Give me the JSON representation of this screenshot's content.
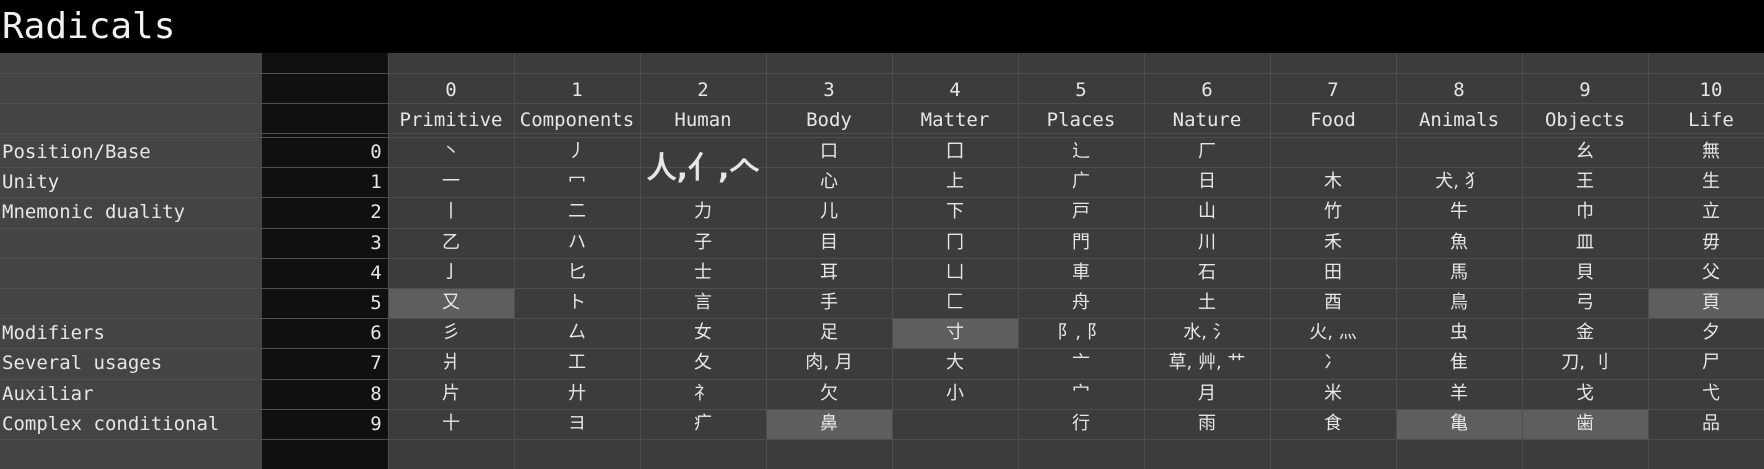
{
  "title": "Radicals",
  "categories": [
    {
      "index": "0",
      "name": "Primitive"
    },
    {
      "index": "1",
      "name": "Components"
    },
    {
      "index": "2",
      "name": "Human"
    },
    {
      "index": "3",
      "name": "Body"
    },
    {
      "index": "4",
      "name": "Matter"
    },
    {
      "index": "5",
      "name": "Places"
    },
    {
      "index": "6",
      "name": "Nature"
    },
    {
      "index": "7",
      "name": "Food"
    },
    {
      "index": "8",
      "name": "Animals"
    },
    {
      "index": "9",
      "name": "Objects"
    },
    {
      "index": "10",
      "name": "Life"
    }
  ],
  "row_labels": [
    "Position/Base",
    "Unity",
    "Mnemonic duality",
    "",
    "",
    "",
    "Modifiers",
    "Several usages",
    "Auxiliar",
    "Complex conditional"
  ],
  "row_numbers": [
    "0",
    "1",
    "2",
    "3",
    "4",
    "5",
    "6",
    "7",
    "8",
    "9"
  ],
  "human_big": "人,亻,𠆢",
  "grid": [
    [
      "丶",
      "丿",
      "",
      "口",
      "囗",
      "辶",
      "厂",
      "",
      "",
      "幺",
      "無"
    ],
    [
      "一",
      "冖",
      "",
      "心",
      "上",
      "广",
      "日",
      "木",
      "犬, 犭",
      "王",
      "生"
    ],
    [
      "丨",
      "二",
      "力",
      "儿",
      "下",
      "戸",
      "山",
      "竹",
      "牛",
      "巾",
      "立"
    ],
    [
      "乙",
      "ハ",
      "子",
      "目",
      "冂",
      "門",
      "川",
      "禾",
      "魚",
      "皿",
      "毋"
    ],
    [
      "亅",
      "匕",
      "士",
      "耳",
      "凵",
      "車",
      "石",
      "田",
      "馬",
      "貝",
      "父"
    ],
    [
      "又",
      "ト",
      "言",
      "手",
      "匚",
      "舟",
      "土",
      "酉",
      "鳥",
      "弓",
      "頁"
    ],
    [
      "彡",
      "厶",
      "女",
      "足",
      "寸",
      "阝, 阝",
      "水, 氵",
      "火, 灬",
      "虫",
      "金",
      "夕"
    ],
    [
      "爿",
      "工",
      "夂",
      "肉, 月",
      "大",
      "亠",
      "草, 艸, 艹",
      "冫",
      "隹",
      "刀, 刂",
      "尸"
    ],
    [
      "片",
      "廾",
      "礻",
      "欠",
      "小",
      "宀",
      "月",
      "米",
      "羊",
      "戈",
      "弋"
    ],
    [
      "十",
      "ヨ",
      "疒",
      "鼻",
      "",
      "行",
      "雨",
      "食",
      "亀",
      "歯",
      "品"
    ]
  ],
  "highlighted_cells": [
    {
      "row": 5,
      "col": 0
    },
    {
      "row": 5,
      "col": 10
    },
    {
      "row": 6,
      "col": 4
    },
    {
      "row": 9,
      "col": 3
    },
    {
      "row": 9,
      "col": 8
    },
    {
      "row": 9,
      "col": 9
    }
  ]
}
